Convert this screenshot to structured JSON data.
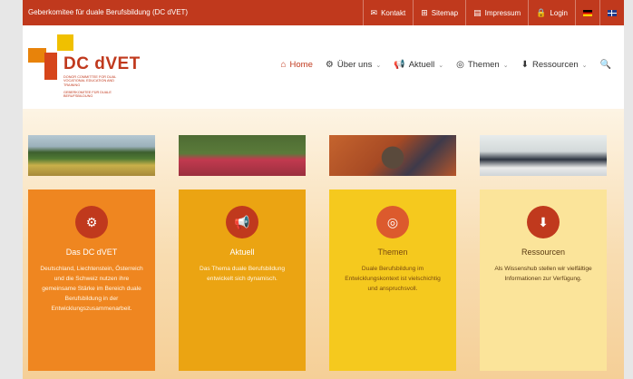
{
  "topbar": {
    "site_name": "Geberkomitee für duale Berufsbildung (DC dVET)",
    "links": [
      {
        "icon": "mail-icon",
        "glyph": "✉",
        "label": "Kontakt"
      },
      {
        "icon": "sitemap-icon",
        "glyph": "⊞",
        "label": "Sitemap"
      },
      {
        "icon": "document-icon",
        "glyph": "▤",
        "label": "Impressum"
      },
      {
        "icon": "lock-icon",
        "glyph": "🔒",
        "label": "Login"
      }
    ],
    "languages": [
      "de-flag-icon",
      "en-flag-icon"
    ]
  },
  "logo": {
    "title": "DC dVET",
    "subtitle_en": "DONOR COMMITTEE FOR DUAL VOCATIONAL EDUCATION AND TRAINING",
    "subtitle_de": "GEBERKOMITEE FÜR DUALE BERUFSBILDUNG"
  },
  "nav": {
    "items": [
      {
        "icon": "home-icon",
        "glyph": "⌂",
        "label": "Home",
        "dropdown": ""
      },
      {
        "icon": "gears-icon",
        "glyph": "⚙",
        "label": "Über uns",
        "dropdown": "⌄"
      },
      {
        "icon": "megaphone-icon",
        "glyph": "📢",
        "label": "Aktuell",
        "dropdown": "⌄"
      },
      {
        "icon": "target-icon",
        "glyph": "◎",
        "label": "Themen",
        "dropdown": "⌄"
      },
      {
        "icon": "download-icon",
        "glyph": "⬇",
        "label": "Ressourcen",
        "dropdown": "⌄"
      }
    ],
    "search_glyph": "🔍"
  },
  "cards": [
    {
      "icon": "gears-icon",
      "glyph": "⚙",
      "title": "Das DC dVET",
      "text": "Deutschland, Liechtenstein, Österreich und die Schweiz nutzen ihre gemeinsame Stärke im Bereich duale Berufsbildung in der Entwicklungszusammenarbeit."
    },
    {
      "icon": "megaphone-icon",
      "glyph": "📢",
      "title": "Aktuell",
      "text": "Das Thema duale Berufsbildung entwickelt sich dynamisch."
    },
    {
      "icon": "target-icon",
      "glyph": "◎",
      "title": "Themen",
      "text": "Duale Berufsbildung im Entwicklungskontext ist vielschichtig und anspruchsvoll."
    },
    {
      "icon": "download-icon",
      "glyph": "⬇",
      "title": "Ressourcen",
      "text": "Als Wissenshub stellen wir vielfältige Informationen zur Verfügung."
    }
  ],
  "colors": {
    "brand_red": "#c0391d",
    "card_orange": "#ef8620",
    "card_amber": "#eba412",
    "card_yellow": "#f5c91e",
    "card_pale": "#fbe49a"
  }
}
